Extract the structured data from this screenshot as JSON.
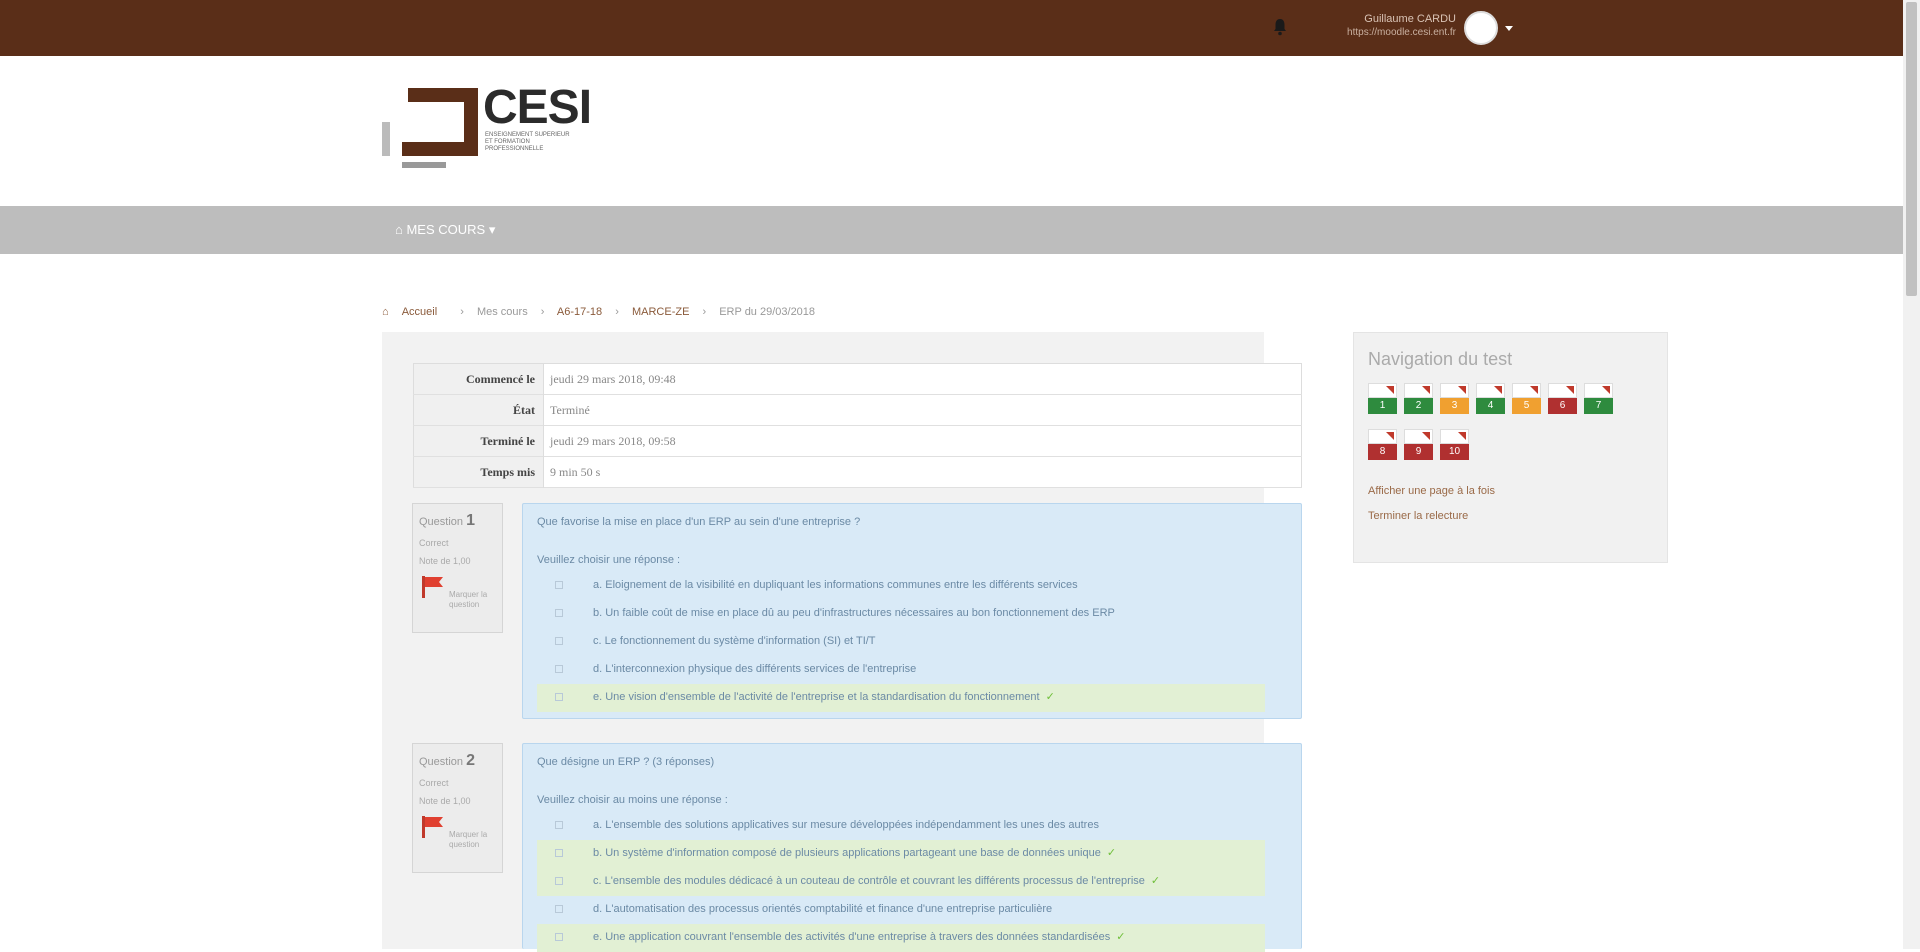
{
  "topbar": {
    "user_name": "Guillaume CARDU",
    "user_email": "https://moodle.cesi.ent.fr"
  },
  "logo": {
    "text": "CESI",
    "subtitle": "ENSEIGNEMENT SUPERIEUR ET FORMATION PROFESSIONNELLE"
  },
  "navbar": {
    "home_label": "MES COURS"
  },
  "breadcrumb": {
    "items": [
      "Accueil",
      "Mes cours",
      "A6-17-18",
      "MARCE-ZE",
      "ERP du 29/03/2018"
    ]
  },
  "summary": {
    "rows": [
      {
        "label": "Commencé le",
        "value": "jeudi 29 mars 2018, 09:48"
      },
      {
        "label": "État",
        "value": "Terminé"
      },
      {
        "label": "Terminé le",
        "value": "jeudi 29 mars 2018, 09:58"
      },
      {
        "label": "Temps mis",
        "value": "9 min 50 s"
      }
    ]
  },
  "questions": [
    {
      "label": "Question",
      "number": "1",
      "state": "Correct",
      "mark": "Note de 1,00",
      "flag_label": "Marquer la question",
      "text": "Que favorise la mise en place d'un ERP au sein d'une entreprise ?",
      "prompt": "Veuillez choisir une réponse :",
      "answers": [
        {
          "text": "a. Eloignement de la visibilité en dupliquant les informations communes entre les différents services",
          "correct": false
        },
        {
          "text": "b. Un faible coût de mise en place dû au peu d'infrastructures nécessaires au bon fonctionnement des ERP",
          "correct": false
        },
        {
          "text": "c. Le fonctionnement du système d'information (SI) et TI/T",
          "correct": false
        },
        {
          "text": "d. L'interconnexion physique des différents services de l'entreprise",
          "correct": false
        },
        {
          "text": "e. Une vision d'ensemble de l'activité de l'entreprise et la standardisation du fonctionnement",
          "correct": true
        }
      ]
    },
    {
      "label": "Question",
      "number": "2",
      "state": "Correct",
      "mark": "Note de 1,00",
      "flag_label": "Marquer la question",
      "text": "Que désigne un ERP ? (3 réponses)",
      "prompt": "Veuillez choisir au moins une réponse :",
      "answers": [
        {
          "text": "a. L'ensemble des solutions applicatives sur mesure développées indépendamment les unes des autres",
          "correct": false
        },
        {
          "text": "b. Un système d'information composé de plusieurs applications partageant une base de données unique",
          "correct": true
        },
        {
          "text": "c. L'ensemble des modules dédicacé à un couteau de contrôle et couvrant les différents processus de l'entreprise",
          "correct": true
        },
        {
          "text": "d. L'automatisation des processus orientés comptabilité et finance d'une entreprise particulière",
          "correct": false
        },
        {
          "text": "e. Une application couvrant l'ensemble des activités d'une entreprise à travers des données standardisées",
          "correct": true
        }
      ]
    }
  ],
  "quiz_nav": {
    "title": "Navigation du test",
    "buttons": [
      {
        "label": "1",
        "state": "correct"
      },
      {
        "label": "2",
        "state": "correct"
      },
      {
        "label": "3",
        "state": "partial"
      },
      {
        "label": "4",
        "state": "correct"
      },
      {
        "label": "5",
        "state": "partial"
      },
      {
        "label": "6",
        "state": "incorrect"
      },
      {
        "label": "7",
        "state": "correct"
      },
      {
        "label": "8",
        "state": "incorrect"
      },
      {
        "label": "9",
        "state": "incorrect"
      },
      {
        "label": "10",
        "state": "incorrect"
      }
    ],
    "show_one_page": "Afficher une page à la fois",
    "finish_review": "Terminer la relecture"
  },
  "colors": {
    "topbar": "#5a2e18",
    "correct": "#2e8b3e",
    "partial": "#f0a030",
    "incorrect": "#b03030"
  }
}
